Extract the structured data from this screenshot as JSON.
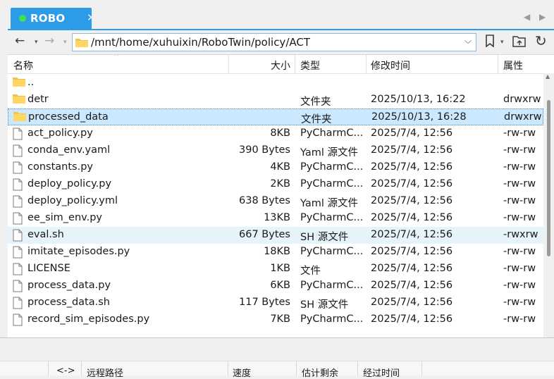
{
  "tab": {
    "title": "ROBO",
    "close": "✕",
    "status_color": "#3ee05b",
    "accent": "#2c9be8"
  },
  "tab_nav": {
    "prev": "◀",
    "next": "▶"
  },
  "toolbar": {
    "back": "←",
    "forward": "→",
    "history_dropdown": "▾",
    "path": "/mnt/home/xuhuixin/RoboTwin/policy/ACT",
    "path_dropdown": "⌵",
    "bookmark_dropdown": "▾",
    "refresh": "↻"
  },
  "columns": {
    "name": "名称",
    "size": "大小",
    "type": "类型",
    "mtime": "修改时间",
    "attr": "属性",
    "sort_indicator": "^"
  },
  "files": [
    {
      "icon": "folder",
      "name": "..",
      "size": "",
      "type": "",
      "mtime": "",
      "attr": ""
    },
    {
      "icon": "folder",
      "name": "detr",
      "size": "",
      "type": "文件夹",
      "mtime": "2025/10/13, 16:22",
      "attr": "drwxrw"
    },
    {
      "icon": "folder",
      "name": "processed_data",
      "size": "",
      "type": "文件夹",
      "mtime": "2025/10/13, 16:28",
      "attr": "drwxrw",
      "state": "selected"
    },
    {
      "icon": "file",
      "name": "act_policy.py",
      "size": "8KB",
      "type": "PyCharmC...",
      "mtime": "2025/7/4, 12:56",
      "attr": "-rw-rw"
    },
    {
      "icon": "file",
      "name": "conda_env.yaml",
      "size": "390 Bytes",
      "type": "Yaml 源文件",
      "mtime": "2025/7/4, 12:56",
      "attr": "-rw-rw"
    },
    {
      "icon": "file",
      "name": "constants.py",
      "size": "4KB",
      "type": "PyCharmC...",
      "mtime": "2025/7/4, 12:56",
      "attr": "-rw-rw"
    },
    {
      "icon": "file",
      "name": "deploy_policy.py",
      "size": "2KB",
      "type": "PyCharmC...",
      "mtime": "2025/7/4, 12:56",
      "attr": "-rw-rw"
    },
    {
      "icon": "file",
      "name": "deploy_policy.yml",
      "size": "638 Bytes",
      "type": "Yaml 源文件",
      "mtime": "2025/7/4, 12:56",
      "attr": "-rw-rw"
    },
    {
      "icon": "file",
      "name": "ee_sim_env.py",
      "size": "13KB",
      "type": "PyCharmC...",
      "mtime": "2025/7/4, 12:56",
      "attr": "-rw-rw"
    },
    {
      "icon": "file",
      "name": "eval.sh",
      "size": "667 Bytes",
      "type": "SH 源文件",
      "mtime": "2025/7/4, 12:56",
      "attr": "-rwxrw",
      "state": "hover"
    },
    {
      "icon": "file",
      "name": "imitate_episodes.py",
      "size": "18KB",
      "type": "PyCharmC...",
      "mtime": "2025/7/4, 12:56",
      "attr": "-rw-rw"
    },
    {
      "icon": "file",
      "name": "LICENSE",
      "size": "1KB",
      "type": "文件",
      "mtime": "2025/7/4, 12:56",
      "attr": "-rw-rw"
    },
    {
      "icon": "file",
      "name": "process_data.py",
      "size": "6KB",
      "type": "PyCharmC...",
      "mtime": "2025/7/4, 12:56",
      "attr": "-rw-rw"
    },
    {
      "icon": "file",
      "name": "process_data.sh",
      "size": "117 Bytes",
      "type": "SH 源文件",
      "mtime": "2025/7/4, 12:56",
      "attr": "-rw-rw"
    },
    {
      "icon": "file",
      "name": "record_sim_episodes.py",
      "size": "7KB",
      "type": "PyCharmC...",
      "mtime": "2025/7/4, 12:56",
      "attr": "-rw-rw"
    }
  ],
  "scroll": {
    "up": "▲",
    "left": "◀",
    "right": "▶"
  },
  "transfer_columns": {
    "direction": "<->",
    "remote_path": "远程路径",
    "speed": "速度",
    "remaining": "估计剩余",
    "elapsed": "经过时间"
  }
}
